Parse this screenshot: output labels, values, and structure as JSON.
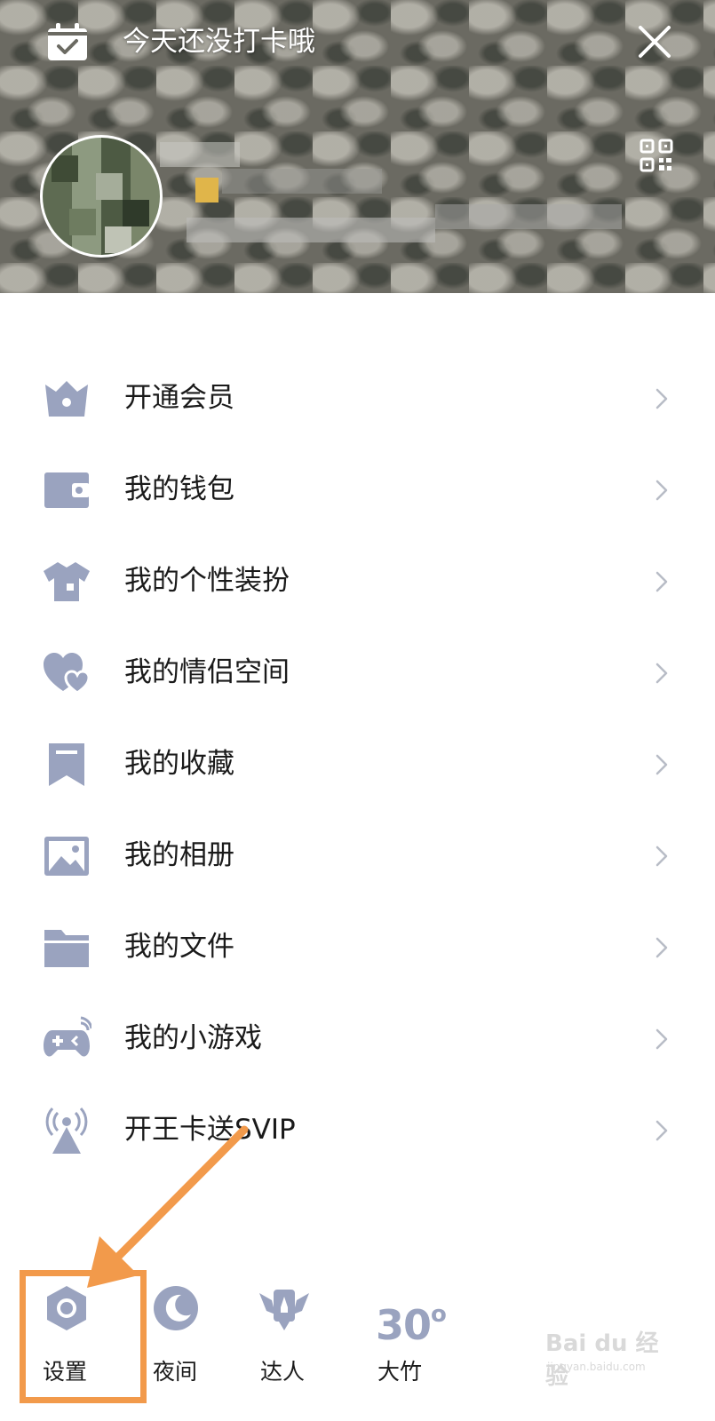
{
  "header": {
    "checkin_text": "今天还没打卡哦"
  },
  "menu": {
    "items": [
      {
        "label": "开通会员",
        "icon": "crown-icon"
      },
      {
        "label": "我的钱包",
        "icon": "wallet-icon"
      },
      {
        "label": "我的个性装扮",
        "icon": "shirt-icon"
      },
      {
        "label": "我的情侣空间",
        "icon": "hearts-icon"
      },
      {
        "label": "我的收藏",
        "icon": "bookmark-icon"
      },
      {
        "label": "我的相册",
        "icon": "picture-icon"
      },
      {
        "label": "我的文件",
        "icon": "folder-icon"
      },
      {
        "label": "我的小游戏",
        "icon": "gamepad-icon"
      },
      {
        "label": "开王卡送SVIP",
        "icon": "signal-tower-icon"
      }
    ]
  },
  "bottom_bar": {
    "settings_label": "设置",
    "night_label": "夜间",
    "daren_label": "达人",
    "weather_label": "大竹",
    "weather_temp": "30",
    "weather_unit": "o"
  },
  "watermark": {
    "brand": "Bai du 经验",
    "url": "jingyan.baidu.com"
  },
  "colors": {
    "icon": "#9aa3bf",
    "highlight": "#f29a4b",
    "header_text": "#ffffff"
  }
}
